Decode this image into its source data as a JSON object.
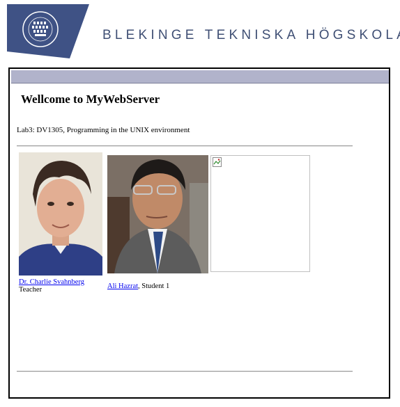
{
  "header": {
    "logo_text": "BLEKINGE TEKNISKA HÖGSKOLA · BTH",
    "university_name": "BLEKINGE TEKNISKA HÖGSKOLA"
  },
  "page": {
    "title": "Wellcome to MyWebServer",
    "subtitle": "Lab3: DV1305, Programming in the UNIX environment"
  },
  "people": [
    {
      "name": "Dr. Charlie Svahnberg",
      "role": "Teacher",
      "separator": ""
    },
    {
      "name": "Ali Hazrat",
      "role": "Student 1",
      "separator": ", "
    }
  ],
  "colors": {
    "brand": "#3f4f74",
    "bar": "#b1b3cb",
    "link": "#0000ee"
  }
}
